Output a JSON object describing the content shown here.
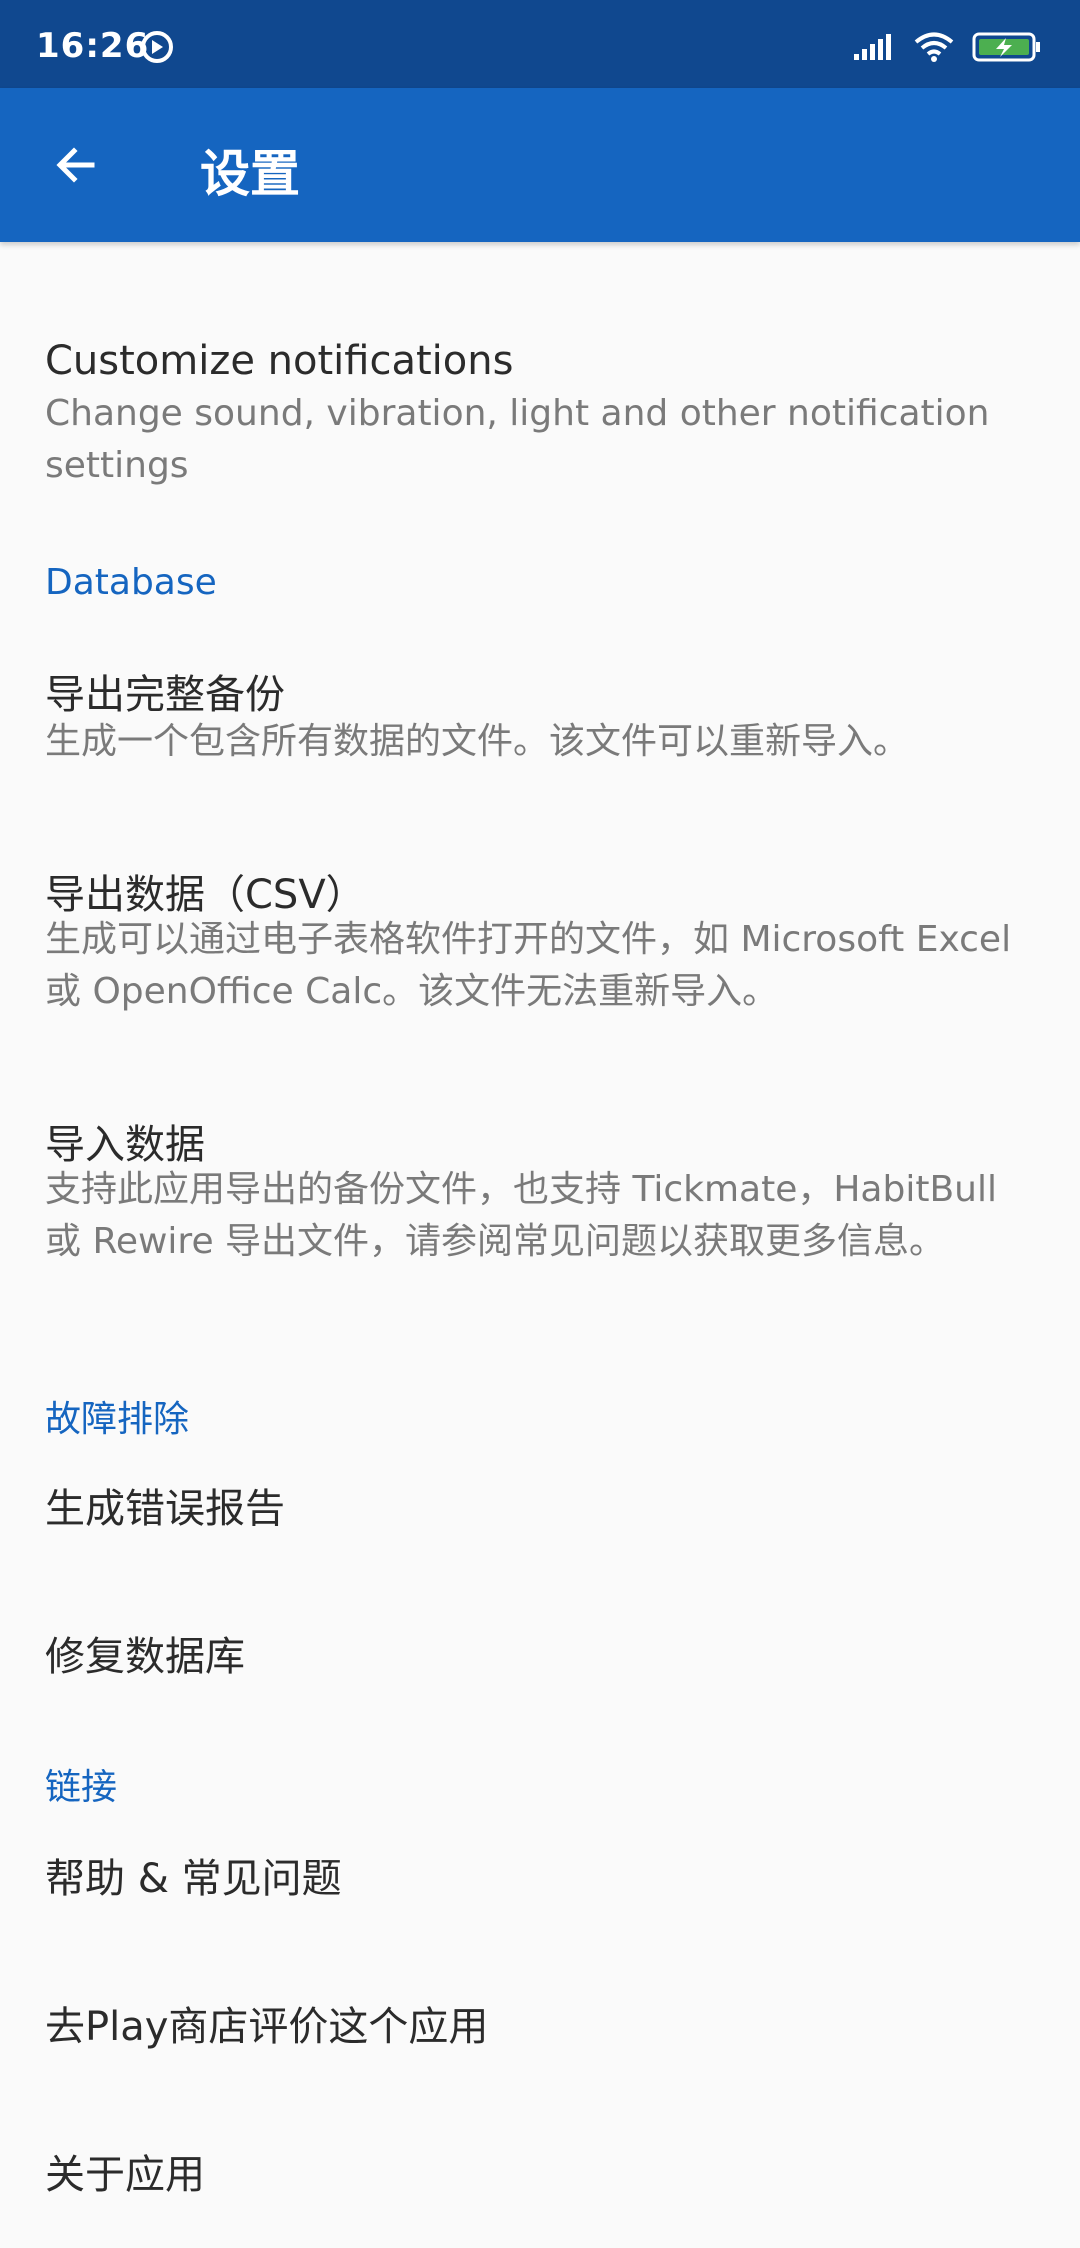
{
  "status_bar": {
    "time": "16:26"
  },
  "app_bar": {
    "title": "设置"
  },
  "items": {
    "customize_notifications": {
      "title": "Customize notifications",
      "summary": "Change sound, vibration, light and other notification settings"
    },
    "database_category": "Database",
    "export_backup": {
      "title": "导出完整备份",
      "summary": "生成一个包含所有数据的文件。该文件可以重新导入。"
    },
    "export_csv": {
      "title": "导出数据（CSV）",
      "summary": "生成可以通过电子表格软件打开的文件，如 Microsoft Excel 或 OpenOffice Calc。该文件无法重新导入。"
    },
    "import_data": {
      "title": "导入数据",
      "summary": "支持此应用导出的备份文件，也支持 Tickmate，HabitBull 或 Rewire 导出文件，请参阅常见问题以获取更多信息。"
    },
    "troubleshooting_category": "故障排除",
    "generate_bug_report": {
      "title": "生成错误报告"
    },
    "repair_database": {
      "title": "修复数据库"
    },
    "links_category": "链接",
    "help_faq": {
      "title": "帮助 & 常见问题"
    },
    "rate_play_store": {
      "title": "去Play商店评价这个应用"
    },
    "about": {
      "title": "关于应用"
    }
  },
  "colors": {
    "status_bar": "#10488f",
    "app_bar": "#1565c0",
    "accent": "#1565c0",
    "background": "#fafafa"
  },
  "icons": {
    "back": "arrow-left-icon",
    "dnd": "do-not-disturb-icon",
    "signal": "signal-icon",
    "wifi": "wifi-icon",
    "battery": "battery-charging-icon"
  }
}
